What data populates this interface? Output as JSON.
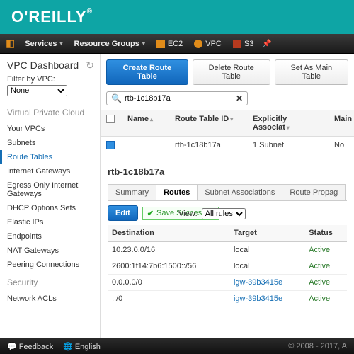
{
  "brand": {
    "name": "O'REILLY",
    "reg": "®"
  },
  "nav": {
    "services": "Services",
    "resource_groups": "Resource Groups",
    "shortcuts": [
      {
        "label": "EC2"
      },
      {
        "label": "VPC"
      },
      {
        "label": "S3"
      }
    ]
  },
  "sidebar": {
    "title": "VPC Dashboard",
    "filter_label": "Filter by VPC:",
    "filter_value": "None",
    "group1": "Virtual Private Cloud",
    "items1": [
      "Your VPCs",
      "Subnets",
      "Route Tables",
      "Internet Gateways",
      "Egress Only Internet Gateways",
      "DHCP Options Sets",
      "Elastic IPs",
      "Endpoints",
      "NAT Gateways",
      "Peering Connections"
    ],
    "group2": "Security",
    "items2": [
      "Network ACLs"
    ]
  },
  "toolbar": {
    "create": "Create Route Table",
    "delete": "Delete Route Table",
    "main": "Set As Main Table"
  },
  "search": {
    "value": "rtb-1c18b17a"
  },
  "table": {
    "headers": {
      "name": "Name",
      "rtid": "Route Table ID",
      "assoc": "Explicitly Associat",
      "main": "Main"
    },
    "rows": [
      {
        "name": "",
        "rtid": "rtb-1c18b17a",
        "assoc": "1 Subnet",
        "main": "No"
      }
    ]
  },
  "detail": {
    "title": "rtb-1c18b17a",
    "tabs": [
      "Summary",
      "Routes",
      "Subnet Associations",
      "Route Propag"
    ],
    "edit": "Edit",
    "save_msg": "Save Successful",
    "view_label": "View:",
    "view_value": "All rules",
    "headers": {
      "dest": "Destination",
      "target": "Target",
      "status": "Status"
    },
    "routes": [
      {
        "dest": "10.23.0.0/16",
        "target": "local",
        "tlink": false,
        "status": "Active"
      },
      {
        "dest": "2600:1f14:7b6:1500::/56",
        "target": "local",
        "tlink": false,
        "status": "Active"
      },
      {
        "dest": "0.0.0.0/0",
        "target": "igw-39b3415e",
        "tlink": true,
        "status": "Active"
      },
      {
        "dest": "::/0",
        "target": "igw-39b3415e",
        "tlink": true,
        "status": "Active"
      }
    ]
  },
  "footer": {
    "feedback": "Feedback",
    "english": "English",
    "copyright": "© 2008 - 2017, A"
  }
}
